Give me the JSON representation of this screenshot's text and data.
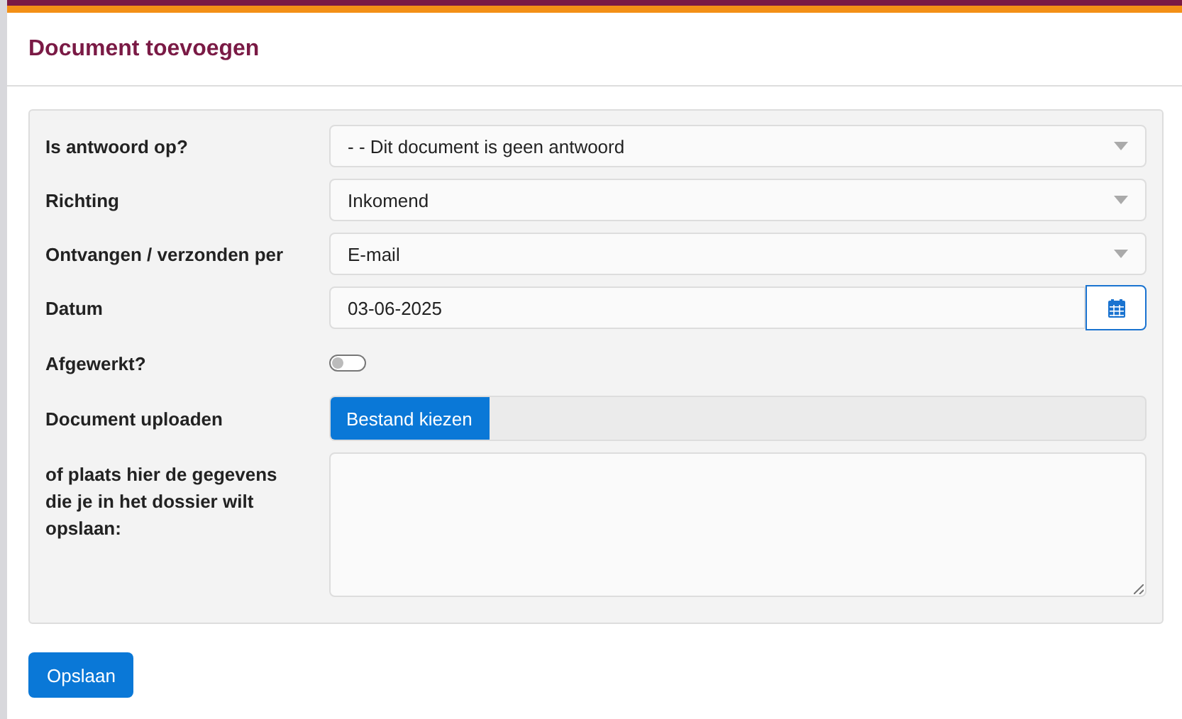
{
  "header": {
    "title": "Document toevoegen"
  },
  "fields": [
    {
      "kind": "select",
      "label": "Is antwoord op?",
      "value": "- - Dit document is geen antwoord"
    },
    {
      "kind": "select",
      "label": "Richting",
      "value": "Inkomend"
    },
    {
      "kind": "select",
      "label": "Ontvangen / verzonden per",
      "value": "E-mail"
    },
    {
      "kind": "date",
      "label": "Datum",
      "value": "03-06-2025"
    },
    {
      "kind": "toggle",
      "label": "Afgewerkt?",
      "on": false
    },
    {
      "kind": "file",
      "label": "Document uploaden",
      "button": "Bestand kiezen"
    },
    {
      "kind": "textarea",
      "label": "of plaats hier de gegevens die je in het dossier wilt opslaan:"
    }
  ],
  "save_button": "Opslaan"
}
